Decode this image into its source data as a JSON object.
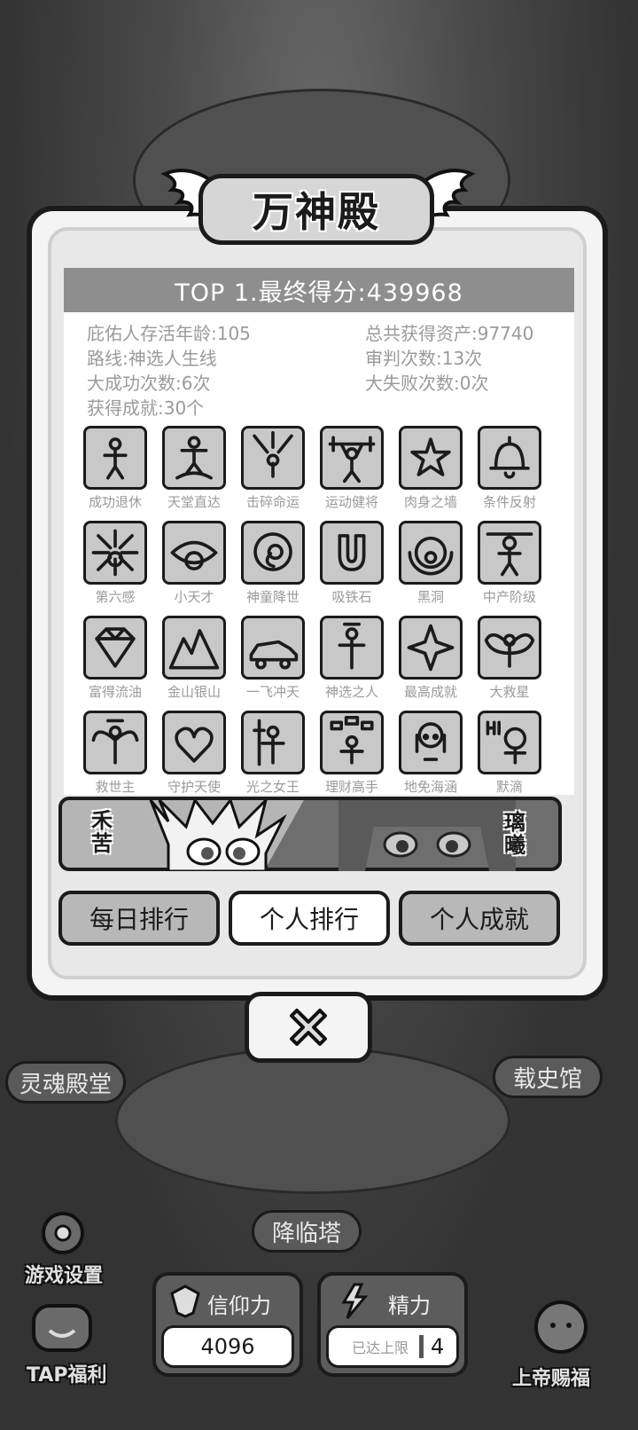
{
  "modal": {
    "title": "万神殿",
    "header": "TOP 1.最终得分:439968",
    "stats": {
      "age": "庇佑人存活年龄:105",
      "assets": "总共获得资产:97740",
      "route": "路线:神选人生线",
      "judgements": "审判次数:13次",
      "successes": "大成功次数:6次",
      "failures": "大失败次数:0次",
      "achievements": "获得成就:30个"
    },
    "achievements": [
      {
        "label": "成功退休",
        "icon": "retire-icon"
      },
      {
        "label": "天堂直达",
        "icon": "heaven-icon"
      },
      {
        "label": "击碎命运",
        "icon": "smash-fate-icon"
      },
      {
        "label": "运动健将",
        "icon": "weightlift-icon"
      },
      {
        "label": "肉身之墙",
        "icon": "body-wall-icon"
      },
      {
        "label": "条件反射",
        "icon": "bell-icon"
      },
      {
        "label": "第六感",
        "icon": "neuron-icon"
      },
      {
        "label": "小天才",
        "icon": "eye-icon"
      },
      {
        "label": "神童降世",
        "icon": "embryo-icon"
      },
      {
        "label": "吸铁石",
        "icon": "magnet-icon"
      },
      {
        "label": "黑洞",
        "icon": "black-hole-icon"
      },
      {
        "label": "中产阶级",
        "icon": "middle-class-icon"
      },
      {
        "label": "富得流油",
        "icon": "diamond-icon"
      },
      {
        "label": "金山银山",
        "icon": "mountain-icon"
      },
      {
        "label": "一飞冲天",
        "icon": "sports-car-icon"
      },
      {
        "label": "神选之人",
        "icon": "chosen-icon"
      },
      {
        "label": "最高成就",
        "icon": "star-badge-icon"
      },
      {
        "label": "大救星",
        "icon": "winged-savior-icon"
      },
      {
        "label": "救世主",
        "icon": "messiah-icon"
      },
      {
        "label": "守护天使",
        "icon": "winged-heart-icon"
      },
      {
        "label": "光之女王",
        "icon": "light-queen-icon"
      },
      {
        "label": "理财高手",
        "icon": "money-icon"
      },
      {
        "label": "地免海涵",
        "icon": "girl-icon"
      },
      {
        "label": "默滴",
        "icon": "hi-icon"
      }
    ],
    "characters": {
      "left_name": "禾苦",
      "right_name": "璃曦"
    },
    "tabs": {
      "daily": "每日排行",
      "personal": "个人排行",
      "achievements": "个人成就"
    }
  },
  "background": {
    "soul_hall": "灵魂殿堂",
    "history_hall": "载史馆",
    "descend_tower": "降临塔",
    "game_settings": "游戏设置",
    "tap_welfare": "TAP福利",
    "god_blessing": "上帝赐福",
    "faith_label": "信仰力",
    "faith_value": "4096",
    "energy_label": "精力",
    "energy_status": "已达上限",
    "energy_value": "4"
  }
}
